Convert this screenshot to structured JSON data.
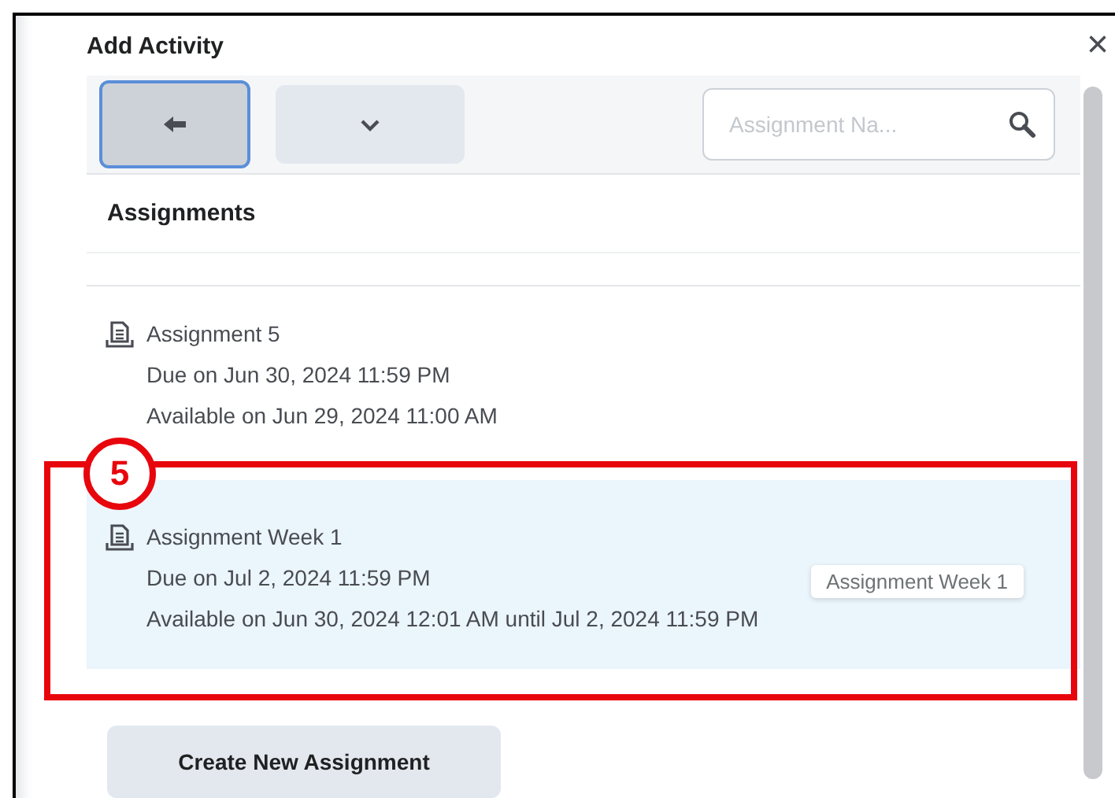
{
  "dialog": {
    "title": "Add Activity",
    "close": "×"
  },
  "toolbar": {
    "buttons": [
      {
        "kind": "back",
        "selected": true
      },
      {
        "kind": "dropdown",
        "selected": false
      }
    ],
    "search": {
      "placeholder": "Assignment Na..."
    }
  },
  "section": {
    "heading": "Assignments"
  },
  "items": [
    {
      "title": "Assignment 5",
      "due": "Due on Jun 30, 2024 11:59 PM",
      "available": "Available on Jun 29, 2024 11:00 AM",
      "selected": false
    },
    {
      "title": "Assignment Week 1",
      "due": "Due on Jul 2, 2024 11:59 PM",
      "available": "Available on Jun 30, 2024 12:01 AM until Jul 2, 2024 11:59 PM",
      "selected": true
    }
  ],
  "tooltip": "Assignment Week 1",
  "annotation": {
    "number": "5"
  },
  "create_button": "Create New Assignment"
}
